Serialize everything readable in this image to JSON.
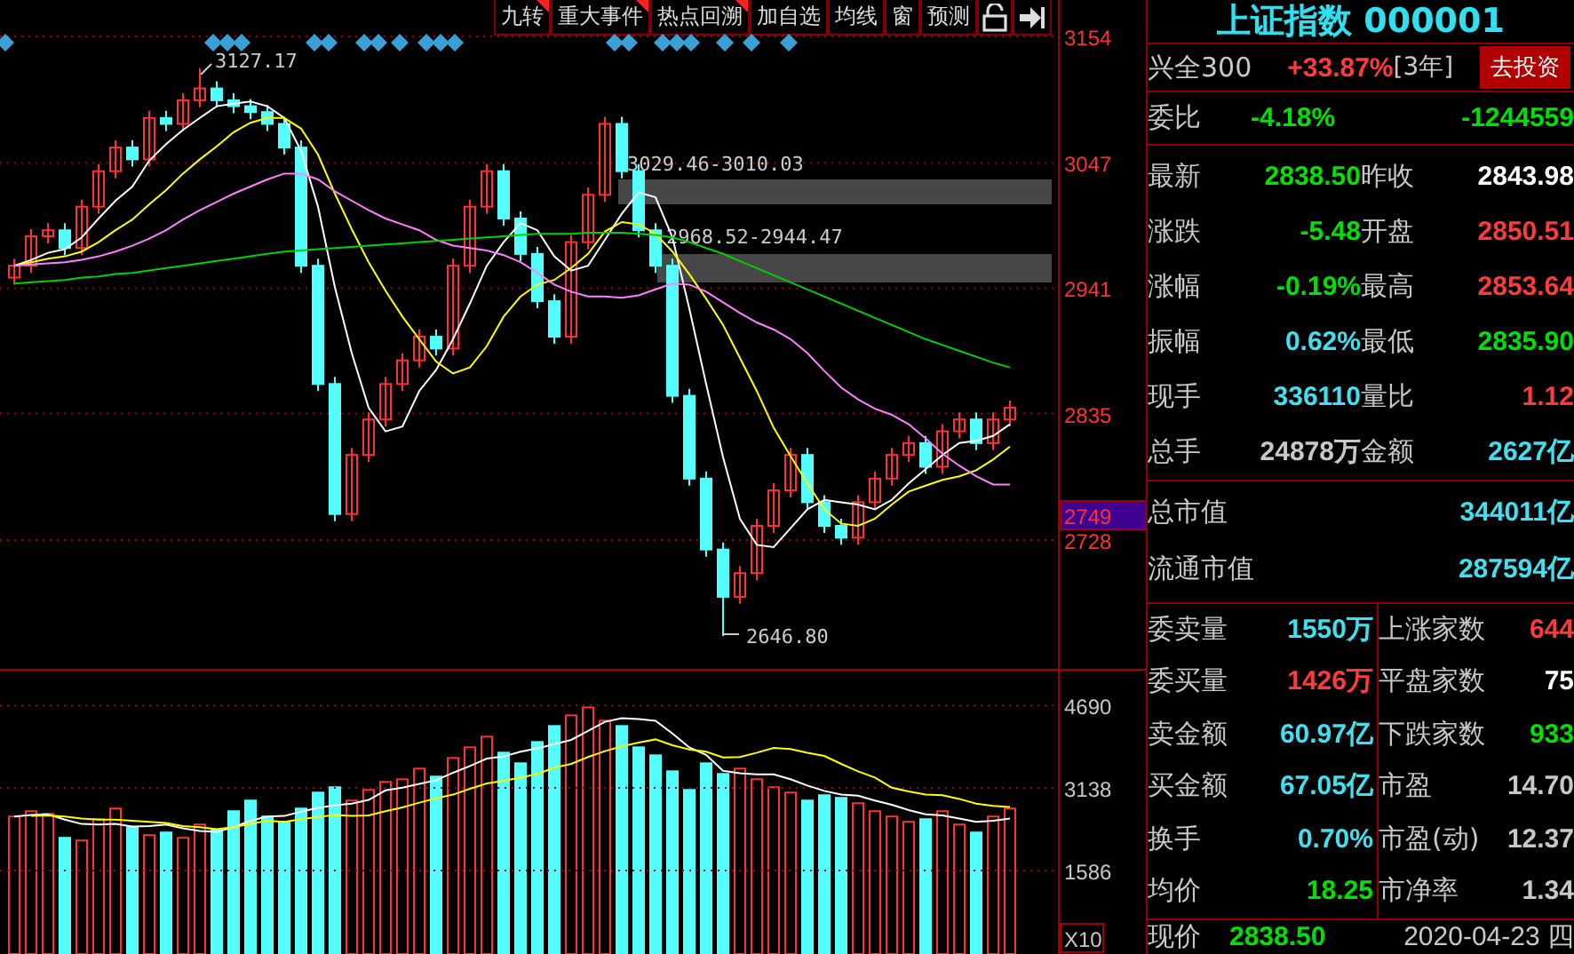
{
  "toolbar": [
    {
      "label": "九转",
      "marked": true
    },
    {
      "label": "重大事件",
      "marked": true
    },
    {
      "label": "热点回溯",
      "marked": true
    },
    {
      "label": "加自选",
      "marked": false
    },
    {
      "label": "均线",
      "marked": false
    },
    {
      "label": "窗",
      "marked": false
    },
    {
      "label": "预测",
      "marked": false
    }
  ],
  "chart": {
    "chart_data": {
      "type": "candlestick",
      "grid": true,
      "ylim": [
        2618.3,
        3184.8
      ],
      "yticks": [
        {
          "value": 3154,
          "label": "3154"
        },
        {
          "value": 3047,
          "label": "3047"
        },
        {
          "value": 2941,
          "label": "2941"
        },
        {
          "value": 2835,
          "label": "2835"
        },
        {
          "value": 2728,
          "label": "2728"
        }
      ],
      "ohlc": [
        [
          2950,
          2966,
          2944,
          2960
        ],
        [
          2960,
          2991,
          2954,
          2985
        ],
        [
          2985,
          2996,
          2979,
          2990
        ],
        [
          2990,
          2996,
          2969,
          2975
        ],
        [
          2975,
          3016,
          2969,
          3010
        ],
        [
          3010,
          3046,
          3004,
          3040
        ],
        [
          3040,
          3066,
          3034,
          3060
        ],
        [
          3060,
          3066,
          3044,
          3050
        ],
        [
          3050,
          3091,
          3044,
          3085
        ],
        [
          3085,
          3091,
          3074,
          3080
        ],
        [
          3080,
          3106,
          3074,
          3100
        ],
        [
          3100,
          3127.17,
          3094,
          3110
        ],
        [
          3110,
          3116,
          3094,
          3100
        ],
        [
          3100,
          3106,
          3089,
          3095
        ],
        [
          3095,
          3101,
          3084,
          3090
        ],
        [
          3090,
          3096,
          3074,
          3080
        ],
        [
          3080,
          3086,
          3054,
          3060
        ],
        [
          3060,
          3066,
          2954,
          2960
        ],
        [
          2960,
          2966,
          2854,
          2860
        ],
        [
          2860,
          2866,
          2744,
          2750
        ],
        [
          2750,
          2806,
          2744,
          2800
        ],
        [
          2800,
          2836,
          2794,
          2830
        ],
        [
          2830,
          2866,
          2824,
          2860
        ],
        [
          2860,
          2886,
          2854,
          2880
        ],
        [
          2880,
          2906,
          2874,
          2900
        ],
        [
          2900,
          2906,
          2884,
          2890
        ],
        [
          2890,
          2966,
          2884,
          2960
        ],
        [
          2960,
          3016,
          2954,
          3010
        ],
        [
          3010,
          3046,
          3004,
          3040
        ],
        [
          3040,
          3046,
          2994,
          3000
        ],
        [
          3000,
          3006,
          2964,
          2970
        ],
        [
          2970,
          2976,
          2924,
          2930
        ],
        [
          2930,
          2936,
          2894,
          2900
        ],
        [
          2900,
          2986,
          2894,
          2980
        ],
        [
          2980,
          3026,
          2974,
          3020
        ],
        [
          3020,
          3086,
          3014,
          3080
        ],
        [
          3080,
          3086,
          3034,
          3040
        ],
        [
          3040,
          3046,
          2984,
          2990
        ],
        [
          2990,
          2996,
          2954,
          2960
        ],
        [
          2960,
          2966,
          2844,
          2850
        ],
        [
          2850,
          2856,
          2774,
          2780
        ],
        [
          2780,
          2786,
          2714,
          2720
        ],
        [
          2720,
          2726,
          2646.8,
          2680
        ],
        [
          2680,
          2706,
          2674,
          2700
        ],
        [
          2700,
          2746,
          2694,
          2740
        ],
        [
          2740,
          2776,
          2734,
          2770
        ],
        [
          2770,
          2806,
          2764,
          2800
        ],
        [
          2800,
          2806,
          2754,
          2760
        ],
        [
          2760,
          2766,
          2734,
          2740
        ],
        [
          2740,
          2746,
          2724,
          2730
        ],
        [
          2730,
          2766,
          2724,
          2760
        ],
        [
          2760,
          2786,
          2754,
          2780
        ],
        [
          2780,
          2806,
          2774,
          2800
        ],
        [
          2800,
          2816,
          2794,
          2810
        ],
        [
          2810,
          2816,
          2784,
          2790
        ],
        [
          2790,
          2826,
          2784,
          2820
        ],
        [
          2820,
          2836,
          2814,
          2830
        ],
        [
          2830,
          2836,
          2804,
          2810
        ],
        [
          2810,
          2836,
          2804,
          2830
        ],
        [
          2830,
          2846,
          2824,
          2840
        ]
      ],
      "series": [
        {
          "type": "line",
          "color": "#ffffff",
          "values": [
            2960,
            2965,
            2971,
            2974,
            2984,
            3000,
            3015,
            3027,
            3049,
            3063,
            3075,
            3085,
            3095,
            3097,
            3099,
            3095,
            3085,
            3057,
            3010,
            2942,
            2886,
            2840,
            2820,
            2824,
            2854,
            2872,
            2898,
            2928,
            2960,
            2980,
            2996,
            2990,
            2968,
            2956,
            2960,
            2982,
            3004,
            3022,
            3018,
            2984,
            2924,
            2860,
            2798,
            2746,
            2724,
            2722,
            2738,
            2754,
            2762,
            2760,
            2758,
            2754,
            2762,
            2776,
            2788,
            2800,
            2810,
            2812,
            2816,
            2826
          ]
        },
        {
          "type": "line",
          "color": "#ffff00",
          "values": [
            2960,
            2963,
            2966,
            2968,
            2972,
            2980,
            2990,
            2999,
            3012,
            3024,
            3038,
            3050,
            3061,
            3073,
            3081,
            3085,
            3085,
            3076,
            3054,
            3021,
            2991,
            2963,
            2939,
            2917,
            2898,
            2879,
            2869,
            2874,
            2892,
            2917,
            2934,
            2944,
            2948,
            2958,
            2970,
            2989,
            2997,
            2995,
            2987,
            2972,
            2953,
            2932,
            2910,
            2882,
            2854,
            2823,
            2799,
            2776,
            2754,
            2742,
            2740,
            2746,
            2758,
            2769,
            2774,
            2779,
            2782,
            2787,
            2796,
            2807
          ]
        },
        {
          "type": "line",
          "color": "#ff80ff",
          "values": [
            2960,
            2961,
            2962,
            2963,
            2965,
            2968,
            2972,
            2977,
            2983,
            2990,
            2999,
            3007,
            3014,
            3021,
            3027,
            3033,
            3038,
            3038,
            3033,
            3023,
            3015,
            3007,
            3000,
            2995,
            2990,
            2982,
            2977,
            2975,
            2973,
            2969,
            2963,
            2954,
            2944,
            2938,
            2934,
            2934,
            2933,
            2935,
            2940,
            2945,
            2944,
            2938,
            2929,
            2920,
            2912,
            2906,
            2898,
            2886,
            2871,
            2857,
            2847,
            2839,
            2834,
            2826,
            2814,
            2801,
            2791,
            2782,
            2775,
            2775
          ]
        },
        {
          "type": "line",
          "color": "#00d000",
          "values": [
            2945,
            2946,
            2947,
            2948,
            2950,
            2951,
            2953,
            2954,
            2956,
            2958,
            2960,
            2962,
            2964,
            2966,
            2968,
            2970,
            2972,
            2973,
            2974,
            2975,
            2976,
            2977,
            2978,
            2979,
            2980,
            2981,
            2982,
            2983,
            2984,
            2985,
            2986,
            2987,
            2987,
            2987,
            2988,
            2988,
            2988,
            2987,
            2986,
            2984,
            2980,
            2975,
            2970,
            2964,
            2958,
            2952,
            2946,
            2940,
            2934,
            2928,
            2922,
            2916,
            2910,
            2904,
            2898,
            2893,
            2888,
            2883,
            2878,
            2874
          ]
        }
      ]
    },
    "current_price": "2749",
    "annotations": [
      {
        "kind": "high",
        "text": "3127.17"
      },
      {
        "kind": "gap",
        "text": "3029.46-3010.03"
      },
      {
        "kind": "gap",
        "text": "2968.52-2944.47"
      },
      {
        "kind": "low",
        "text": "2646.80"
      }
    ]
  },
  "volume": {
    "chart_data": {
      "type": "bar",
      "grid": true,
      "ylim": [
        17.2,
        5357.5
      ],
      "yticks": [
        {
          "value": 4690,
          "label": "4690"
        },
        {
          "value": 3138,
          "label": "3138"
        },
        {
          "value": 1586,
          "label": "1586"
        }
      ],
      "series": [
        {
          "color": "#ff3232",
          "values": [
            2600,
            2700,
            2650,
            null,
            2150,
            2550,
            2750,
            null,
            2250,
            null,
            2200,
            2450,
            null,
            null,
            null,
            null,
            null,
            null,
            null,
            null,
            2900,
            3100,
            3250,
            3300,
            3500,
            null,
            3700,
            3900,
            4100,
            null,
            null,
            null,
            null,
            4500,
            4650,
            4400,
            null,
            null,
            null,
            null,
            null,
            null,
            null,
            3500,
            3300,
            3150,
            3050,
            null,
            null,
            null,
            2850,
            2700,
            2600,
            2500,
            null,
            2700,
            2450,
            null,
            2600,
            2750
          ]
        },
        {
          "color": "#54ffff",
          "values": [
            null,
            null,
            null,
            2200,
            null,
            null,
            null,
            2400,
            null,
            2300,
            null,
            null,
            2350,
            2700,
            2900,
            2600,
            2500,
            2750,
            3050,
            3150,
            null,
            null,
            null,
            null,
            null,
            3350,
            null,
            null,
            null,
            3800,
            3600,
            4000,
            4300,
            null,
            null,
            null,
            4300,
            3900,
            3750,
            3450,
            3100,
            3600,
            3400,
            null,
            null,
            null,
            null,
            2900,
            3000,
            2950,
            null,
            null,
            null,
            null,
            2550,
            null,
            null,
            2300,
            null,
            null
          ]
        },
        {
          "type": "line",
          "color": "#ffffff",
          "values": [
            2600,
            2630,
            2640,
            2540,
            2460,
            2450,
            2460,
            2410,
            2420,
            2450,
            2380,
            2330,
            2310,
            2400,
            2520,
            2600,
            2610,
            2690,
            2760,
            2810,
            2840,
            2910,
            3090,
            3140,
            3210,
            3280,
            3420,
            3550,
            3690,
            3730,
            3820,
            3880,
            3960,
            4040,
            4210,
            4380,
            4450,
            4430,
            4400,
            4160,
            3900,
            3760,
            3460,
            3410,
            3390,
            3390,
            3300,
            3180,
            3080,
            3010,
            2990,
            2900,
            2820,
            2720,
            2640,
            2620,
            2560,
            2500,
            2520,
            2560
          ]
        },
        {
          "type": "line",
          "color": "#ffff00",
          "values": [
            null,
            2610,
            2620,
            2600,
            2560,
            2540,
            2540,
            2520,
            2500,
            2480,
            2420,
            2400,
            2360,
            2400,
            2460,
            2520,
            2500,
            2550,
            2590,
            2630,
            2610,
            2620,
            2700,
            2770,
            2860,
            2940,
            3010,
            3120,
            3220,
            3270,
            3330,
            3400,
            3520,
            3590,
            3720,
            3830,
            3920,
            3990,
            4050,
            3940,
            3860,
            3820,
            3710,
            3720,
            3800,
            3890,
            3870,
            3800,
            3740,
            3590,
            3450,
            3330,
            3140,
            3070,
            3010,
            3000,
            2930,
            2840,
            2800,
            2780
          ]
        }
      ]
    },
    "scale": "X10"
  },
  "panel": {
    "title": "上证指数 000001",
    "promo": {
      "label": "兴全300",
      "change": "+33.87%",
      "period": "[3年]",
      "button": "去投资"
    },
    "ratio": {
      "label": "委比",
      "percent": "-4.18%",
      "value": "-1244559",
      "color": "#00e000"
    },
    "quotes": [
      {
        "left": {
          "label": "最新",
          "value": "2838.50",
          "color": "#00e000"
        },
        "right": {
          "label": "昨收",
          "value": "2843.98",
          "color": "#ffffff"
        }
      },
      {
        "left": {
          "label": "涨跌",
          "value": "-5.48",
          "color": "#00e000"
        },
        "right": {
          "label": "开盘",
          "value": "2850.51",
          "color": "#ff3b3b"
        }
      },
      {
        "left": {
          "label": "涨幅",
          "value": "-0.19%",
          "color": "#00e000"
        },
        "right": {
          "label": "最高",
          "value": "2853.64",
          "color": "#ff3b3b"
        }
      },
      {
        "left": {
          "label": "振幅",
          "value": "0.62%",
          "color": "#40e0f0"
        },
        "right": {
          "label": "最低",
          "value": "2835.90",
          "color": "#00e000"
        }
      },
      {
        "left": {
          "label": "现手",
          "value": "336110",
          "color": "#40e0f0"
        },
        "right": {
          "label": "量比",
          "value": "1.12",
          "color": "#ff3b3b"
        }
      },
      {
        "left": {
          "label": "总手",
          "value": "24878万",
          "color": "#c8c8c8"
        },
        "right": {
          "label": "金额",
          "value": "2627亿",
          "color": "#40e0f0"
        }
      }
    ],
    "market": [
      {
        "label": "总市值",
        "value": "344011亿",
        "color": "#40e0f0"
      },
      {
        "label": "流通市值",
        "value": "287594亿",
        "color": "#40e0f0"
      }
    ],
    "stats": [
      {
        "left": {
          "label": "委卖量",
          "value": "1550万",
          "color": "#40e0f0"
        },
        "right": {
          "label": "上涨家数",
          "value": "644",
          "color": "#ff3b3b"
        }
      },
      {
        "left": {
          "label": "委买量",
          "value": "1426万",
          "color": "#ff3b3b"
        },
        "right": {
          "label": "平盘家数",
          "value": "75",
          "color": "#ffffff"
        }
      },
      {
        "left": {
          "label": "卖金额",
          "value": "60.97亿",
          "color": "#40e0f0"
        },
        "right": {
          "label": "下跌家数",
          "value": "933",
          "color": "#00e000"
        }
      },
      {
        "left": {
          "label": "买金额",
          "value": "67.05亿",
          "color": "#40e0f0"
        },
        "right": {
          "label": "市盈",
          "value": "14.70",
          "color": "#c8c8c8"
        }
      },
      {
        "left": {
          "label": "换手",
          "value": "0.70%",
          "color": "#40e0f0"
        },
        "right": {
          "label": "市盈(动)",
          "value": "12.37",
          "color": "#c8c8c8"
        }
      },
      {
        "left": {
          "label": "均价",
          "value": "18.25",
          "color": "#00e000"
        },
        "right": {
          "label": "市净率",
          "value": "1.34",
          "color": "#c8c8c8"
        }
      }
    ],
    "footer": {
      "label": "现价",
      "value": "2838.50",
      "color": "#00e000",
      "date": "2020-04-23 四"
    }
  }
}
